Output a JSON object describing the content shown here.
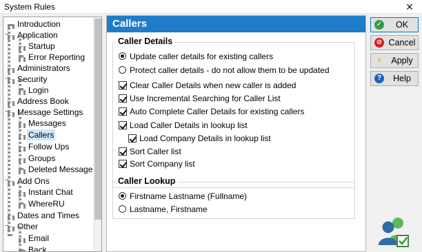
{
  "window": {
    "title": "System Rules",
    "close_glyph": "✕"
  },
  "tree": {
    "items": [
      {
        "label": "Introduction"
      },
      {
        "label": "Application",
        "expander": "−"
      },
      {
        "label": "Startup"
      },
      {
        "label": "Error Reporting"
      },
      {
        "label": "Administrators"
      },
      {
        "label": "Security",
        "expander": "−"
      },
      {
        "label": "Login"
      },
      {
        "label": "Address Book"
      },
      {
        "label": "Message Settings",
        "expander": "−"
      },
      {
        "label": "Messages"
      },
      {
        "label": "Callers",
        "selected": true
      },
      {
        "label": "Follow Ups"
      },
      {
        "label": "Groups"
      },
      {
        "label": "Deleted Messages"
      },
      {
        "label": "Add Ons",
        "expander": "−"
      },
      {
        "label": "Instant Chat"
      },
      {
        "label": "WhereRU"
      },
      {
        "label": "Dates and Times"
      },
      {
        "label": "Other",
        "expander": "−"
      },
      {
        "label": "Email"
      },
      {
        "label": "Back..."
      }
    ]
  },
  "panel": {
    "title": "Callers",
    "caller_details": {
      "title": "Caller Details",
      "radios": [
        {
          "label": "Update caller details for existing callers",
          "selected": true
        },
        {
          "label": "Protect caller details - do not allow them to be updated",
          "selected": false
        }
      ],
      "checks": [
        {
          "label": "Clear Caller Details when new caller is added",
          "checked": true
        },
        {
          "label": "Use Incremental Searching for Caller List",
          "checked": true
        },
        {
          "label": "Auto Complete Caller Details for existing callers",
          "checked": true
        },
        {
          "label": "Load Caller Details in lookup list",
          "checked": true
        },
        {
          "label": "Load Company Details in lookup list",
          "checked": true
        },
        {
          "label": "Sort Caller list",
          "checked": true
        },
        {
          "label": "Sort Company list",
          "checked": true
        }
      ]
    },
    "caller_lookup": {
      "title": "Caller Lookup",
      "radios": [
        {
          "label": "Firstname Lastname (Fullname)",
          "selected": true
        },
        {
          "label": "Lastname, Firstname",
          "selected": false
        }
      ]
    }
  },
  "buttons": {
    "ok": {
      "label": "OK",
      "icon": "check-circle-icon",
      "color": "#2e9e47",
      "glyph": "✓"
    },
    "cancel": {
      "label": "Cancel",
      "icon": "no-entry-icon",
      "color": "#d21f1f",
      "glyph": "⊘"
    },
    "apply": {
      "label": "Apply",
      "icon": "lightning-icon",
      "color": "#f4a21a",
      "glyph": "⚡"
    },
    "help": {
      "label": "Help",
      "icon": "question-circle-icon",
      "color": "#1e63b8",
      "glyph": "?"
    }
  },
  "colors": {
    "accent": "#1f7cc8",
    "selection": "#cce8ff"
  }
}
